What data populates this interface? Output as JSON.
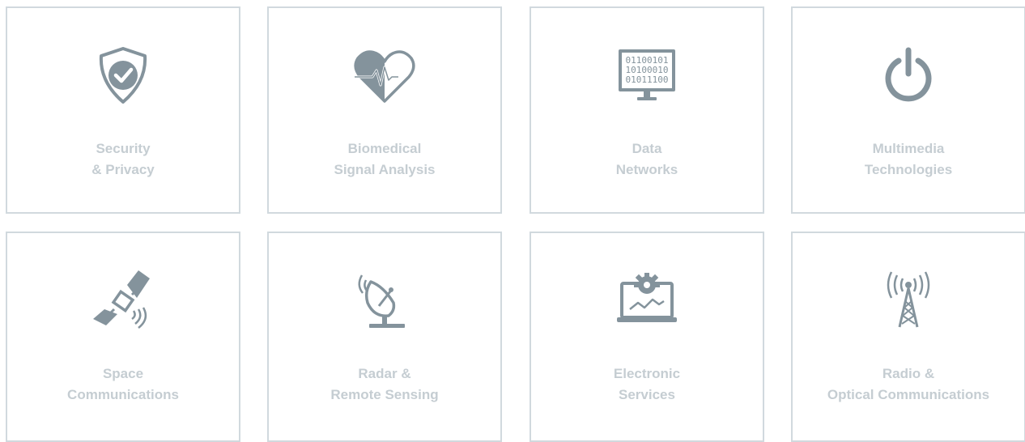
{
  "colors": {
    "icon": "#84939c",
    "label": "#c5cdd2",
    "border": "#d1d9de"
  },
  "cards": [
    {
      "icon": "shield-check-icon",
      "line1": "Security",
      "line2": "& Privacy"
    },
    {
      "icon": "heart-pulse-icon",
      "line1": "Biomedical",
      "line2": "Signal Analysis"
    },
    {
      "icon": "binary-monitor-icon",
      "line1": "Data",
      "line2": "Networks",
      "binary": [
        "01100101",
        "10100010",
        "01011100"
      ]
    },
    {
      "icon": "power-icon",
      "line1": "Multimedia",
      "line2": "Technologies"
    },
    {
      "icon": "satellite-icon",
      "line1": "Space",
      "line2": "Communications"
    },
    {
      "icon": "radar-dish-icon",
      "line1": "Radar &",
      "line2": "Remote Sensing"
    },
    {
      "icon": "laptop-gear-icon",
      "line1": "Electronic",
      "line2": "Services"
    },
    {
      "icon": "radio-tower-icon",
      "line1": "Radio &",
      "line2": "Optical Communications"
    }
  ]
}
